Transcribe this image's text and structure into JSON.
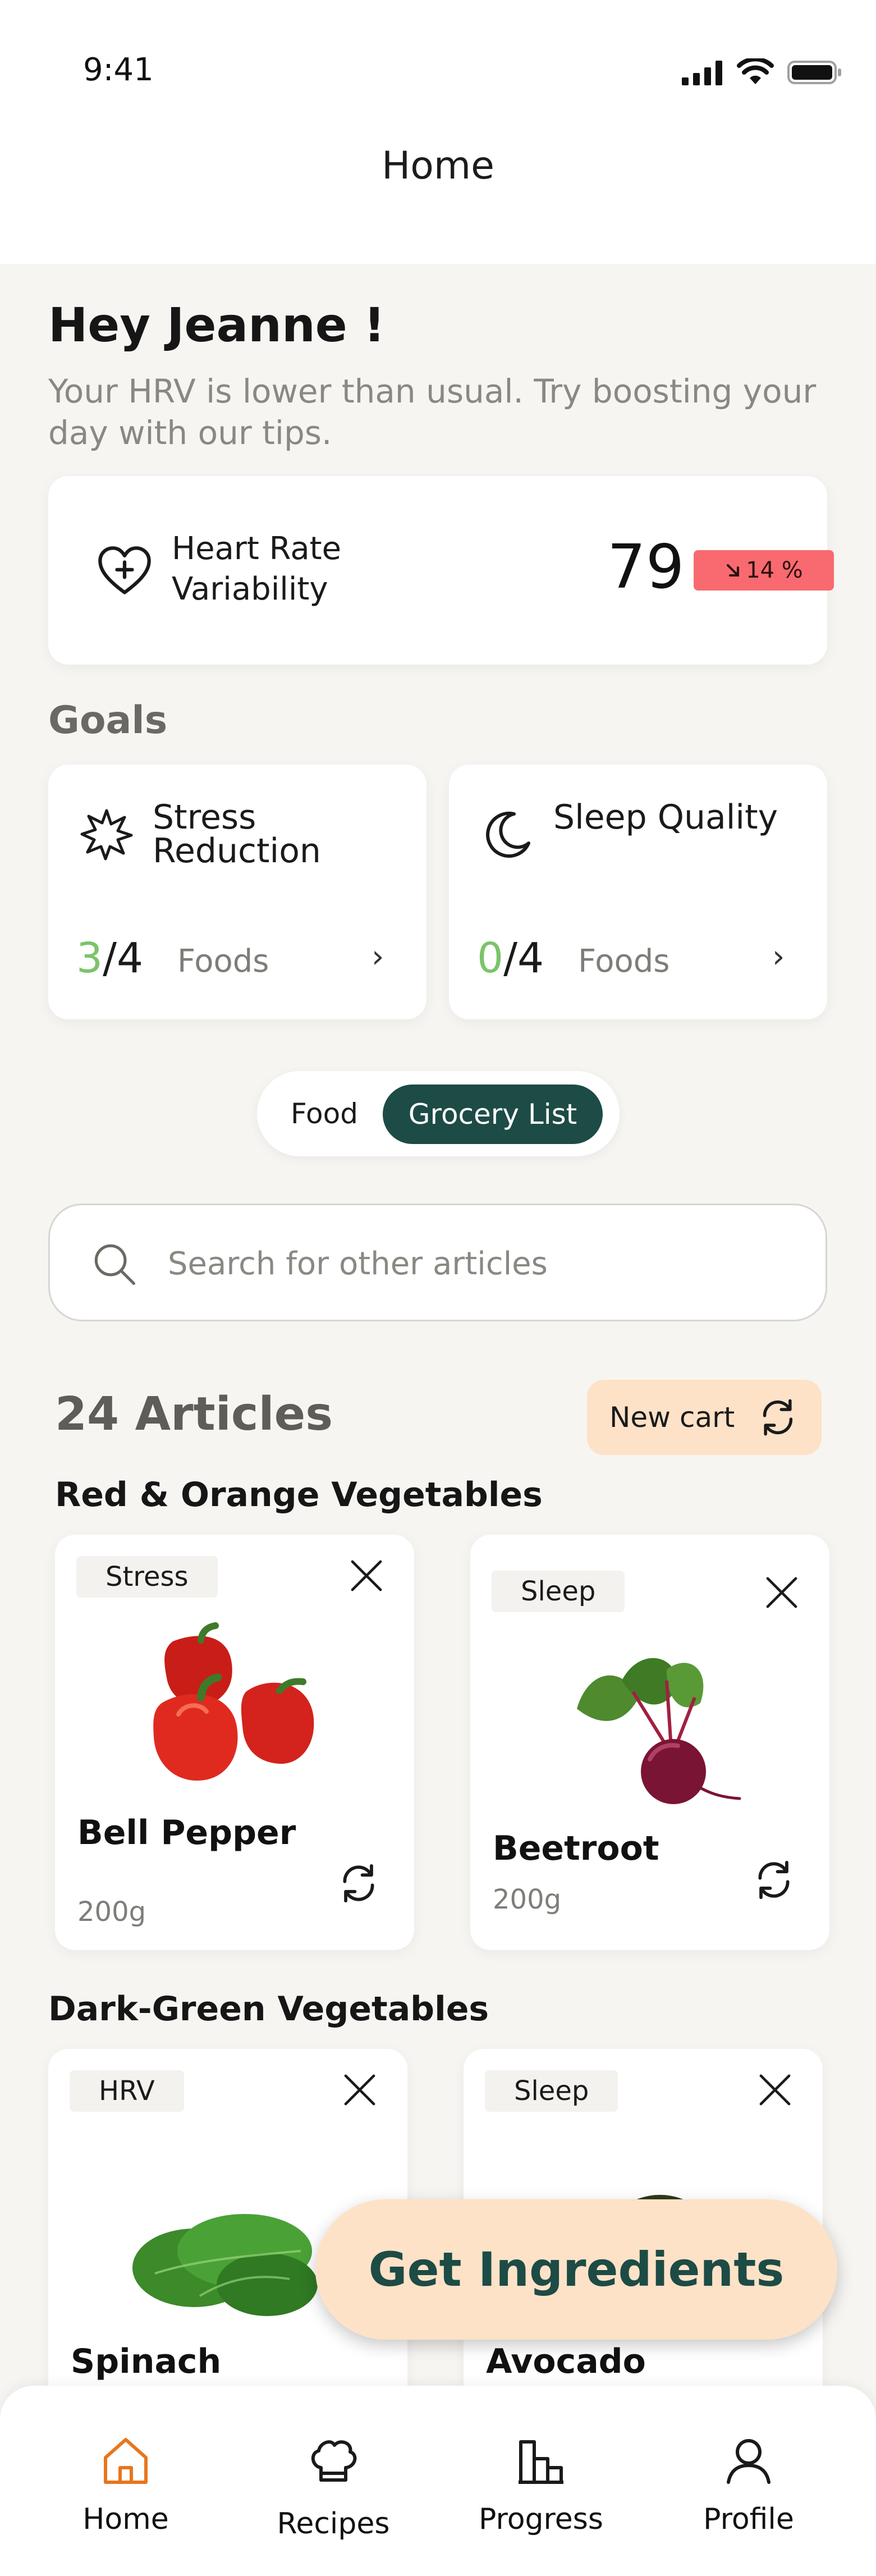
{
  "status_bar": {
    "time": "9:41"
  },
  "header": {
    "title": "Home"
  },
  "greeting": {
    "title": "Hey Jeanne !",
    "subtitle": "Your HRV is lower than usual. Try boosting your day with our tips."
  },
  "hrv": {
    "label": "Heart Rate Variability",
    "value": "79",
    "change": "14 %",
    "change_color": "#f86a6f"
  },
  "goals": {
    "title": "Goals",
    "items": [
      {
        "name": "Stress Reduction",
        "icon": "stress-burst-icon",
        "done": "3",
        "total": "/4",
        "unit": "Foods"
      },
      {
        "name": "Sleep Quality",
        "icon": "moon-icon",
        "done": "0",
        "total": "/4",
        "unit": "Foods"
      }
    ]
  },
  "toggle": {
    "food": "Food",
    "grocery": "Grocery List",
    "active": "Grocery List"
  },
  "search": {
    "placeholder": "Search for other articles"
  },
  "articles": {
    "count": "24 Articles",
    "new_cart": "New cart"
  },
  "categories": [
    {
      "title": "Red & Orange Vegetables",
      "items": [
        {
          "tag": "Stress",
          "name": "Bell Pepper",
          "weight": "200g"
        },
        {
          "tag": "Sleep",
          "name": "Beetroot",
          "weight": "200g"
        }
      ]
    },
    {
      "title": "Dark-Green Vegetables",
      "items": [
        {
          "tag": "HRV",
          "name": "Spinach",
          "weight": ""
        },
        {
          "tag": "Sleep",
          "name": "Avocado",
          "weight": ""
        }
      ]
    }
  ],
  "cta": {
    "label": "Get Ingredients"
  },
  "tabs": [
    {
      "label": "Home",
      "active": true
    },
    {
      "label": "Recipes",
      "active": false
    },
    {
      "label": "Progress",
      "active": false
    },
    {
      "label": "Profile",
      "active": false
    }
  ],
  "colors": {
    "accent_dark_green": "#1d4b45",
    "accent_peach": "#fde2c8",
    "active_tab": "#e8761e",
    "progress_green": "#7ac46a"
  }
}
